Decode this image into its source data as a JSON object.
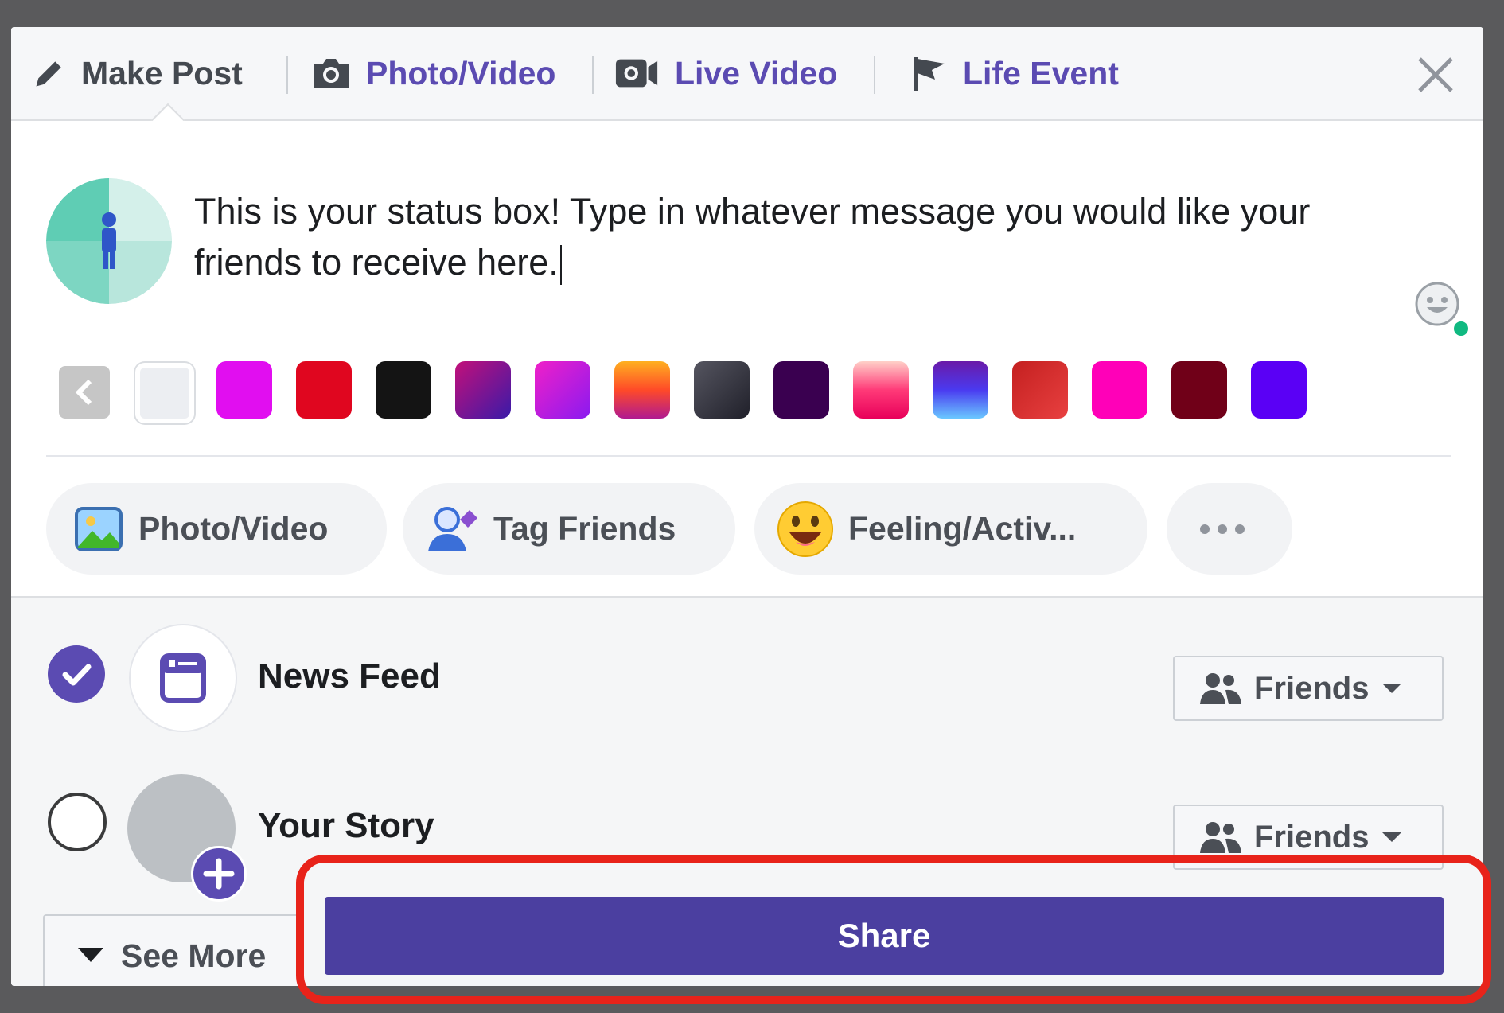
{
  "tabs": {
    "make_post": "Make Post",
    "photo_video": "Photo/Video",
    "live_video": "Live Video",
    "life_event": "Life Event"
  },
  "composer": {
    "status_text": "This is your status box! Type in whatever message you would like your friends to receive here."
  },
  "backgrounds": [
    "#eceef2",
    "#e10ef0",
    "#e0061f",
    "#141414",
    "#8a1ab8",
    "#c81ee8",
    "#f0a020",
    "#3a3a45",
    "#3a0050",
    "#ff4070",
    "#5d3de0",
    "#d42828",
    "#ff00b8",
    "#700018",
    "#5a00f5"
  ],
  "actions": {
    "photo_video": "Photo/Video",
    "tag_friends": "Tag Friends",
    "feeling": "Feeling/Activ..."
  },
  "destinations": {
    "news_feed": "News Feed",
    "your_story": "Your Story",
    "friends_label": "Friends"
  },
  "footer": {
    "see_more": "See More",
    "share": "Share"
  },
  "colors": {
    "accent": "#5b4bb2",
    "share_button": "#4b3fa0",
    "highlight": "#e8231a"
  }
}
